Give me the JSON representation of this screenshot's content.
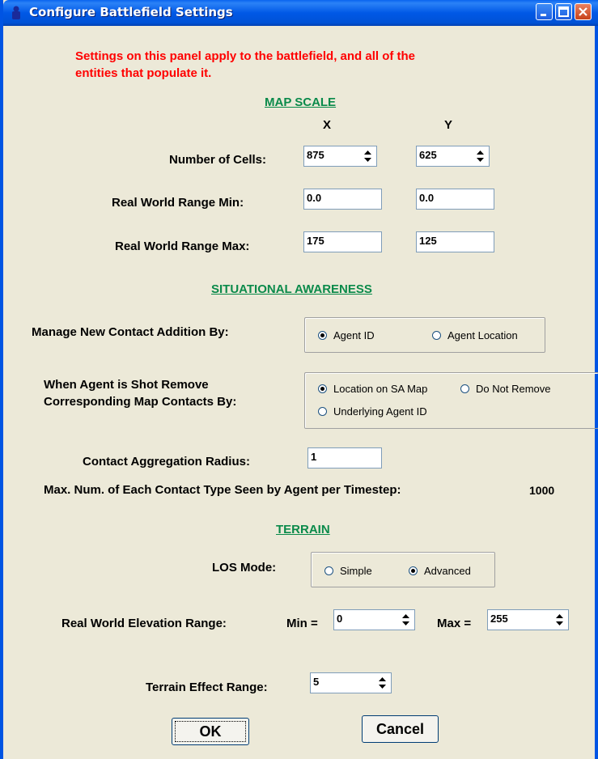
{
  "window": {
    "title": "Configure Battlefield Settings"
  },
  "notice": {
    "line1": "Settings on this panel apply to the battlefield, and all of the",
    "line2": "entities that populate it."
  },
  "map_scale": {
    "heading": "MAP SCALE",
    "col_x": "X",
    "col_y": "Y",
    "cells_label": "Number of Cells:",
    "cells_x": "875",
    "cells_y": "625",
    "min_label": "Real World Range Min:",
    "min_x": "0.0",
    "min_y": "0.0",
    "max_label": "Real World Range Max:",
    "max_x": "175",
    "max_y": "125"
  },
  "sa": {
    "heading": "SITUATIONAL AWARENESS",
    "contact_label": "Manage New Contact Addition By:",
    "contact_opt1": "Agent ID",
    "contact_opt2": "Agent Location",
    "shot_label1": "When Agent is Shot Remove",
    "shot_label2": "Corresponding Map Contacts By:",
    "shot_opt1": "Location on SA Map",
    "shot_opt2": "Do Not Remove",
    "shot_opt3": "Underlying Agent ID",
    "radius_label": "Contact Aggregation Radius:",
    "radius_value": "1",
    "maxnum_label": "Max. Num. of Each Contact Type Seen by Agent per Timestep:",
    "maxnum_value": "1000"
  },
  "terrain": {
    "heading": "TERRAIN",
    "los_label": "LOS Mode:",
    "los_opt1": "Simple",
    "los_opt2": "Advanced",
    "elev_label": "Real World Elevation Range:",
    "min_label": "Min =",
    "min_value": "0",
    "max_label": "Max =",
    "max_value": "255",
    "effect_label": "Terrain Effect Range:",
    "effect_value": "5"
  },
  "buttons": {
    "ok": "OK",
    "cancel": "Cancel"
  },
  "colors": {
    "titlebar": "#0058e6",
    "warning": "#ff0000",
    "section": "#0a8a4a",
    "background": "#ece9d8"
  }
}
